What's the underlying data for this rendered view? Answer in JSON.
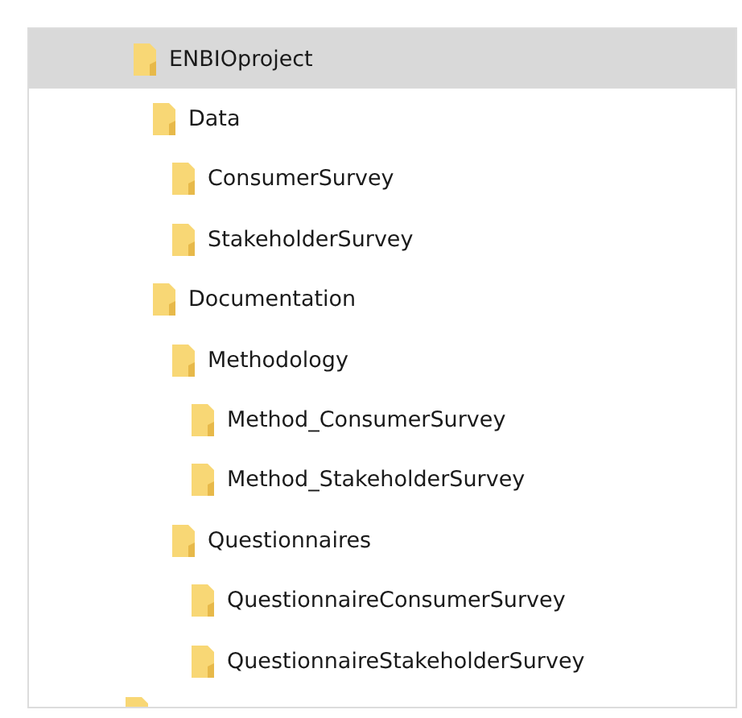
{
  "tree": [
    {
      "label": "ENBIOproject",
      "selected": true,
      "children": [
        {
          "label": "Data",
          "selected": false,
          "children": [
            {
              "label": "ConsumerSurvey",
              "selected": false
            },
            {
              "label": "StakeholderSurvey",
              "selected": false
            }
          ]
        },
        {
          "label": "Documentation",
          "selected": false,
          "children": [
            {
              "label": "Methodology",
              "selected": false,
              "children": [
                {
                  "label": "Method_ConsumerSurvey",
                  "selected": false
                },
                {
                  "label": "Method_StakeholderSurvey",
                  "selected": false
                }
              ]
            },
            {
              "label": "Questionnaires",
              "selected": false,
              "children": [
                {
                  "label": "QuestionnaireConsumerSurvey",
                  "selected": false
                },
                {
                  "label": "QuestionnaireStakeholderSurvey",
                  "selected": false
                }
              ]
            }
          ]
        }
      ]
    }
  ]
}
